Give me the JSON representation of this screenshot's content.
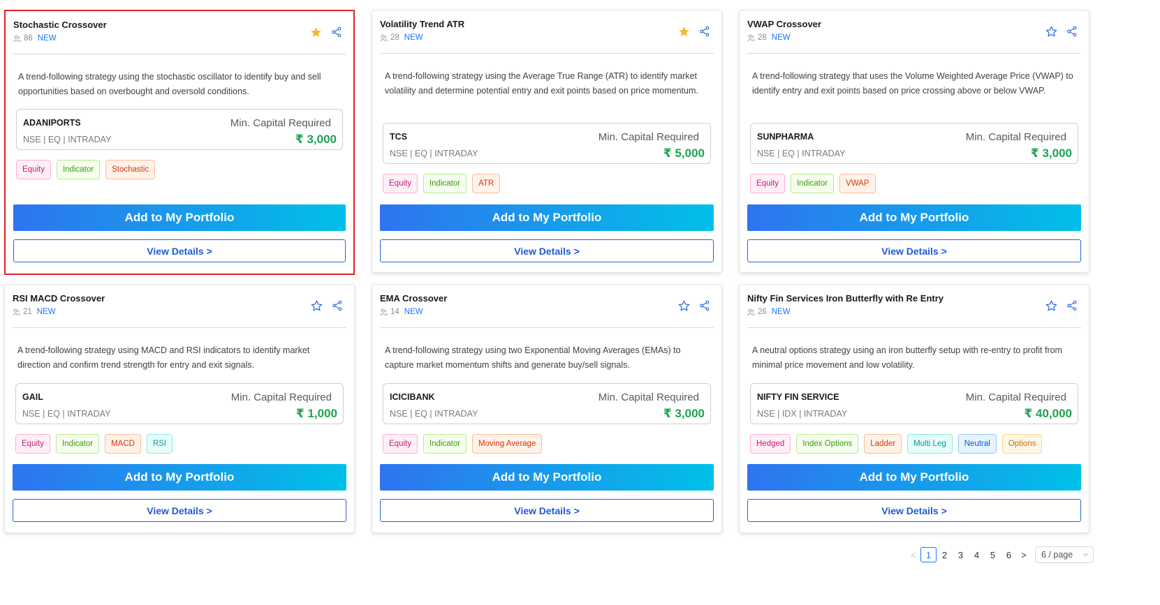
{
  "cards": [
    {
      "title": "Stochastic Crossover",
      "users": "86",
      "new_label": "NEW",
      "favorited": true,
      "description": "A trend-following strategy using the stochastic oscillator to identify buy and sell opportunities based on overbought and oversold conditions.",
      "symbol": "ADANIPORTS",
      "sub": "NSE | EQ | INTRADAY",
      "capital_label": "Min. Capital Required",
      "capital": "₹ 3,000",
      "tags": [
        {
          "label": "Equity",
          "color": "magenta"
        },
        {
          "label": "Indicator",
          "color": "green"
        },
        {
          "label": "Stochastic",
          "color": "volcano"
        }
      ],
      "add_label": "Add to My Portfolio",
      "view_label": "View Details >"
    },
    {
      "title": "Volatility Trend ATR",
      "users": "28",
      "new_label": "NEW",
      "favorited": true,
      "description": "A trend-following strategy using the Average True Range (ATR) to identify market volatility and determine potential entry and exit points based on price momentum.",
      "symbol": "TCS",
      "sub": "NSE | EQ | INTRADAY",
      "capital_label": "Min. Capital Required",
      "capital": "₹ 5,000",
      "tags": [
        {
          "label": "Equity",
          "color": "magenta"
        },
        {
          "label": "Indicator",
          "color": "green"
        },
        {
          "label": "ATR",
          "color": "volcano"
        }
      ],
      "add_label": "Add to My Portfolio",
      "view_label": "View Details >"
    },
    {
      "title": "VWAP Crossover",
      "users": "28",
      "new_label": "NEW",
      "favorited": false,
      "description": "A trend-following strategy that uses the Volume Weighted Average Price (VWAP) to identify entry and exit points based on price crossing above or below VWAP.",
      "symbol": "SUNPHARMA",
      "sub": "NSE | EQ | INTRADAY",
      "capital_label": "Min. Capital Required",
      "capital": "₹ 3,000",
      "tags": [
        {
          "label": "Equity",
          "color": "magenta"
        },
        {
          "label": "Indicator",
          "color": "green"
        },
        {
          "label": "VWAP",
          "color": "volcano"
        }
      ],
      "add_label": "Add to My Portfolio",
      "view_label": "View Details >"
    },
    {
      "title": "RSI MACD Crossover",
      "users": "21",
      "new_label": "NEW",
      "favorited": false,
      "description": "A trend-following strategy using MACD and RSI indicators to identify market direction and confirm trend strength for entry and exit signals.",
      "symbol": "GAIL",
      "sub": "NSE | EQ | INTRADAY",
      "capital_label": "Min. Capital Required",
      "capital": "₹ 1,000",
      "tags": [
        {
          "label": "Equity",
          "color": "magenta"
        },
        {
          "label": "Indicator",
          "color": "green"
        },
        {
          "label": "MACD",
          "color": "volcano"
        },
        {
          "label": "RSI",
          "color": "cyan"
        }
      ],
      "add_label": "Add to My Portfolio",
      "view_label": "View Details >"
    },
    {
      "title": "EMA Crossover",
      "users": "14",
      "new_label": "NEW",
      "favorited": false,
      "description": "A trend-following strategy using two Exponential Moving Averages (EMAs) to capture market momentum shifts and generate buy/sell signals.",
      "symbol": "ICICIBANK",
      "sub": "NSE | EQ | INTRADAY",
      "capital_label": "Min. Capital Required",
      "capital": "₹ 3,000",
      "tags": [
        {
          "label": "Equity",
          "color": "magenta"
        },
        {
          "label": "Indicator",
          "color": "green"
        },
        {
          "label": "Moving Average",
          "color": "volcano"
        }
      ],
      "add_label": "Add to My Portfolio",
      "view_label": "View Details >"
    },
    {
      "title": "Nifty Fin Services Iron Butterfly with Re Entry",
      "users": "26",
      "new_label": "NEW",
      "favorited": false,
      "description": "A neutral options strategy using an iron butterfly setup with re-entry to profit from minimal price movement and low volatility.",
      "symbol": "NIFTY FIN SERVICE",
      "sub": "NSE | IDX | INTRADAY",
      "capital_label": "Min. Capital Required",
      "capital": "₹ 40,000",
      "tags": [
        {
          "label": "Hedged",
          "color": "magenta"
        },
        {
          "label": "Index Options",
          "color": "green"
        },
        {
          "label": "Ladder",
          "color": "volcano"
        },
        {
          "label": "Multi Leg",
          "color": "cyan"
        },
        {
          "label": "Neutral",
          "color": "blue"
        },
        {
          "label": "Options",
          "color": "orange"
        }
      ],
      "add_label": "Add to My Portfolio",
      "view_label": "View Details >"
    }
  ],
  "pagination": {
    "prev": "<",
    "next": ">",
    "pages": [
      "1",
      "2",
      "3",
      "4",
      "5",
      "6"
    ],
    "current": "1",
    "page_size": "6 / page"
  },
  "colors": {
    "star_filled": "#f5b82e",
    "icon_blue": "#2f6fe0",
    "capital_green": "#1fa251",
    "selection_red": "#e0202a"
  }
}
